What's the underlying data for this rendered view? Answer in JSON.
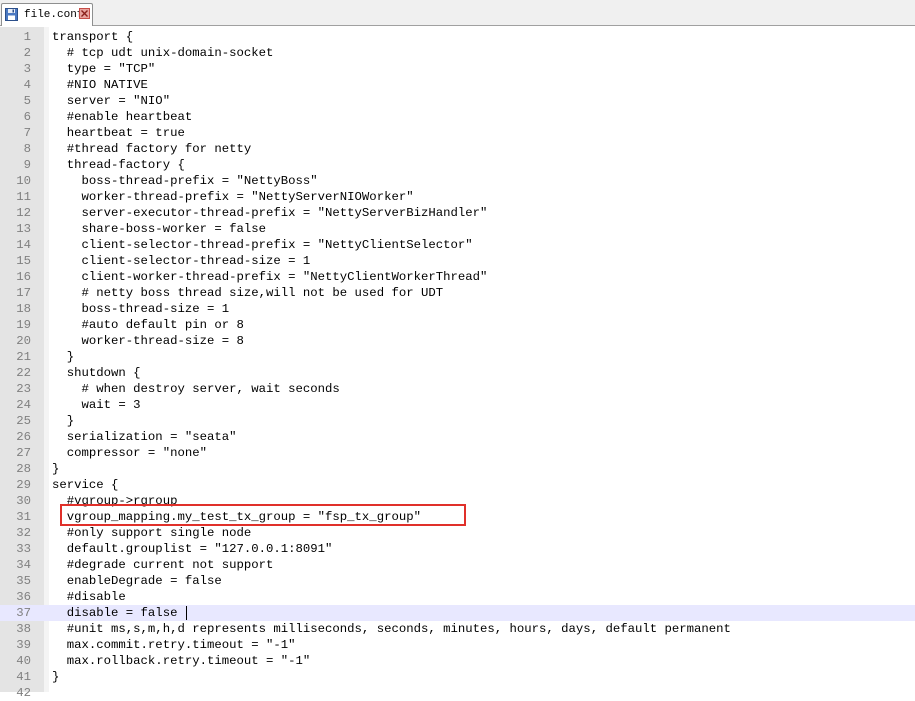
{
  "tab": {
    "filename": "file.conf",
    "save_icon": "floppy-disk-icon",
    "close_icon": "close-icon"
  },
  "editor": {
    "current_line": 37,
    "highlighted_line": 31,
    "highlight_color": "#e0302a",
    "current_line_color": "#e8e8ff",
    "lines": [
      {
        "n": "1",
        "text": "transport {"
      },
      {
        "n": "2",
        "text": "  # tcp udt unix-domain-socket"
      },
      {
        "n": "3",
        "text": "  type = \"TCP\""
      },
      {
        "n": "4",
        "text": "  #NIO NATIVE"
      },
      {
        "n": "5",
        "text": "  server = \"NIO\""
      },
      {
        "n": "6",
        "text": "  #enable heartbeat"
      },
      {
        "n": "7",
        "text": "  heartbeat = true"
      },
      {
        "n": "8",
        "text": "  #thread factory for netty"
      },
      {
        "n": "9",
        "text": "  thread-factory {"
      },
      {
        "n": "10",
        "text": "    boss-thread-prefix = \"NettyBoss\""
      },
      {
        "n": "11",
        "text": "    worker-thread-prefix = \"NettyServerNIOWorker\""
      },
      {
        "n": "12",
        "text": "    server-executor-thread-prefix = \"NettyServerBizHandler\""
      },
      {
        "n": "13",
        "text": "    share-boss-worker = false"
      },
      {
        "n": "14",
        "text": "    client-selector-thread-prefix = \"NettyClientSelector\""
      },
      {
        "n": "15",
        "text": "    client-selector-thread-size = 1"
      },
      {
        "n": "16",
        "text": "    client-worker-thread-prefix = \"NettyClientWorkerThread\""
      },
      {
        "n": "17",
        "text": "    # netty boss thread size,will not be used for UDT"
      },
      {
        "n": "18",
        "text": "    boss-thread-size = 1"
      },
      {
        "n": "19",
        "text": "    #auto default pin or 8"
      },
      {
        "n": "20",
        "text": "    worker-thread-size = 8"
      },
      {
        "n": "21",
        "text": "  }"
      },
      {
        "n": "22",
        "text": "  shutdown {"
      },
      {
        "n": "23",
        "text": "    # when destroy server, wait seconds"
      },
      {
        "n": "24",
        "text": "    wait = 3"
      },
      {
        "n": "25",
        "text": "  }"
      },
      {
        "n": "26",
        "text": "  serialization = \"seata\""
      },
      {
        "n": "27",
        "text": "  compressor = \"none\""
      },
      {
        "n": "28",
        "text": "}"
      },
      {
        "n": "29",
        "text": "service {"
      },
      {
        "n": "30",
        "text": "  #vgroup->rgroup"
      },
      {
        "n": "31",
        "text": "  vgroup_mapping.my_test_tx_group = \"fsp_tx_group\""
      },
      {
        "n": "32",
        "text": "  #only support single node"
      },
      {
        "n": "33",
        "text": "  default.grouplist = \"127.0.0.1:8091\""
      },
      {
        "n": "34",
        "text": "  #degrade current not support"
      },
      {
        "n": "35",
        "text": "  enableDegrade = false"
      },
      {
        "n": "36",
        "text": "  #disable"
      },
      {
        "n": "37",
        "text": "  disable = false"
      },
      {
        "n": "38",
        "text": "  #unit ms,s,m,h,d represents milliseconds, seconds, minutes, hours, days, default permanent"
      },
      {
        "n": "39",
        "text": "  max.commit.retry.timeout = \"-1\""
      },
      {
        "n": "40",
        "text": "  max.rollback.retry.timeout = \"-1\""
      },
      {
        "n": "41",
        "text": "}"
      },
      {
        "n": "42",
        "text": ""
      }
    ]
  }
}
